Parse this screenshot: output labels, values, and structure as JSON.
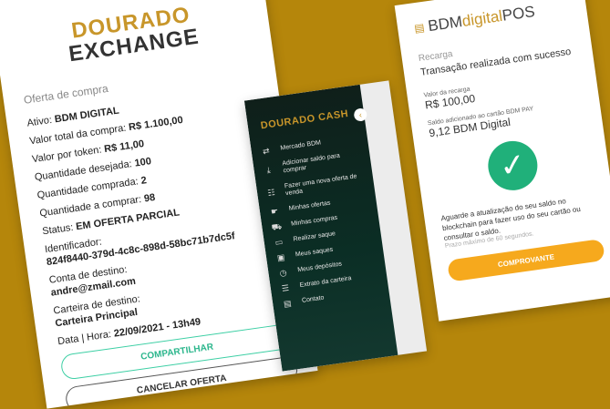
{
  "exchange": {
    "logo_top": "DOURADO",
    "logo_bottom": "EXCHANGE",
    "section_title": "Oferta de compra",
    "rows": [
      {
        "label": "Ativo: ",
        "value": "BDM DIGITAL"
      },
      {
        "label": "Valor total da compra: ",
        "value": "R$ 1.100,00"
      },
      {
        "label": "Valor por token: ",
        "value": "R$ 11,00"
      },
      {
        "label": "Quantidade desejada: ",
        "value": "100"
      },
      {
        "label": "Quantidade comprada: ",
        "value": "2"
      },
      {
        "label": "Quantidade a comprar: ",
        "value": "98"
      },
      {
        "label": "Status: ",
        "value": "EM OFERTA PARCIAL"
      }
    ],
    "identifier_label": "Identificador:",
    "identifier_value": "824f8440-379d-4c8c-898d-58bc71b7dc5f",
    "destination_account_label": "Conta de destino:",
    "destination_account_value": "andre@zmail.com",
    "destination_wallet_label": "Carteira de destino:",
    "destination_wallet_value": "Carteira Principal",
    "datetime_label": "Data | Hora: ",
    "datetime_value": "22/09/2021 - 13h49",
    "share_button": "COMPARTILHAR",
    "cancel_button": "CANCELAR OFERTA"
  },
  "cash": {
    "logo": "DOURADO CASH",
    "collapse_icon": "chevron-left-icon",
    "menu": [
      {
        "label": "Mercado BDM",
        "icon": "shuffle-icon"
      },
      {
        "label": "Adicionar saldo para comprar",
        "icon": "download-icon"
      },
      {
        "label": "Fazer uma nova oferta de venda",
        "icon": "new-offer-icon"
      },
      {
        "label": "Minhas ofertas",
        "icon": "hand-icon"
      },
      {
        "label": "Minhas compras",
        "icon": "cart-icon"
      },
      {
        "label": "Realizar saque",
        "icon": "withdraw-icon"
      },
      {
        "label": "Meus saques",
        "icon": "wallet-icon"
      },
      {
        "label": "Meus depósitos",
        "icon": "clock-icon"
      },
      {
        "label": "Extrato da carteira",
        "icon": "list-icon"
      },
      {
        "label": "Contato",
        "icon": "document-icon"
      }
    ]
  },
  "pos": {
    "logo_left": "BDM",
    "logo_mid": "digital",
    "logo_right": "POS",
    "section": "Recarga",
    "success": "Transação realizada com sucesso",
    "amount_label": "Valor da recarga",
    "amount_value": "R$ 100,00",
    "balance_label": "Saldo adicionado ao cartão BDM PAY",
    "balance_value": "9,12 BDM Digital",
    "notice": "Aguarde a atualização do seu saldo no blockchain para fazer uso do seu cartão ou consultar o saldo.",
    "max_time": "Prazo máximo de 60 segundos.",
    "button": "COMPROVANTE",
    "accent": "#f6a91d",
    "success_color": "#20b07a"
  }
}
